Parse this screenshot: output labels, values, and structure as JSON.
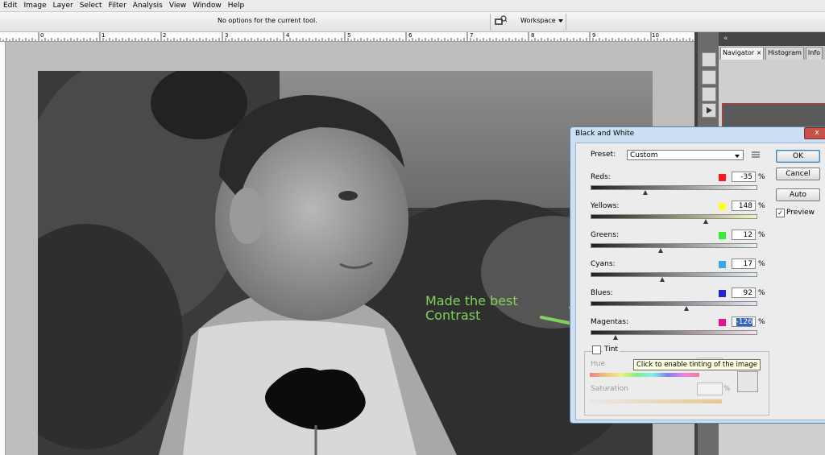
{
  "menu": [
    "Edit",
    "Image",
    "Layer",
    "Select",
    "Filter",
    "Analysis",
    "View",
    "Window",
    "Help"
  ],
  "options_bar": {
    "message": "No options for the current tool.",
    "workspace": "Workspace"
  },
  "ruler": {
    "labels": [
      "0",
      "1",
      "2",
      "3",
      "4",
      "5",
      "6",
      "7",
      "8",
      "9",
      "10"
    ]
  },
  "panels": {
    "tabs": [
      "Navigator",
      "Histogram",
      "Info"
    ],
    "collapse": "«"
  },
  "dialog": {
    "title": "Black and White",
    "close": "x",
    "preset_label": "Preset:",
    "preset_value": "Custom",
    "buttons": {
      "ok": "OK",
      "cancel": "Cancel",
      "auto": "Auto"
    },
    "preview_label": "Preview",
    "preview_checked": true,
    "channels": [
      {
        "label": "Reds:",
        "value": "-35",
        "color": "#ff1a1a"
      },
      {
        "label": "Yellows:",
        "value": "148",
        "color": "#ffff2a"
      },
      {
        "label": "Greens:",
        "value": "12",
        "color": "#33ee33"
      },
      {
        "label": "Cyans:",
        "value": "17",
        "color": "#3aa8e8"
      },
      {
        "label": "Blues:",
        "value": "92",
        "color": "#2424cc"
      },
      {
        "label": "Magentas:",
        "value": "-126",
        "color": "#e0168a"
      }
    ],
    "percent_sign": "%",
    "tint_label": "Tint",
    "hue_label": "Hue",
    "saturation_label": "Saturation",
    "tooltip": "Click to enable tinting of the image"
  },
  "annotation": {
    "line1": "Made the best",
    "line2": "Contrast"
  },
  "colors": {
    "annotation": "#7ed35a",
    "dialog_frame": "#cbe0f3"
  }
}
